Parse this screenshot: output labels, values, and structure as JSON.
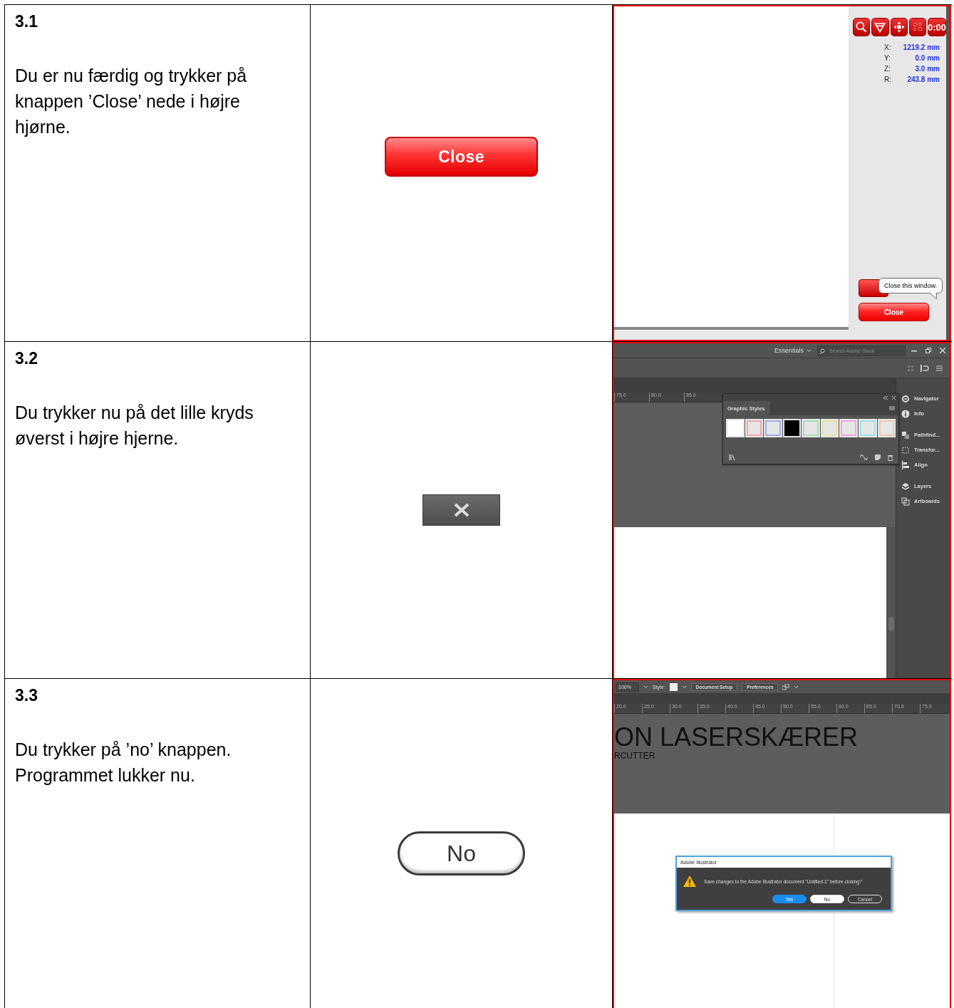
{
  "rows": [
    {
      "step": "3.1",
      "instruction": "Du er nu færdig og trykker på knappen ’Close’ nede i højre hjørne.",
      "button": {
        "kind": "red",
        "label": "Close"
      },
      "screenshot": {
        "kind": "laser-panel",
        "toolbar": {
          "timer": "0:00"
        },
        "coordinates": [
          {
            "axis": "X:",
            "value": "1219.2 mm"
          },
          {
            "axis": "Y:",
            "value": "0.0 mm"
          },
          {
            "axis": "Z:",
            "value": "3.0 mm"
          },
          {
            "axis": "R:",
            "value": "243.8 mm"
          }
        ],
        "tooltip": "Close this window.",
        "close_button": "Close"
      }
    },
    {
      "step": "3.2",
      "instruction": "Du trykker nu på det lille kryds øverst i højre hjerne.",
      "button": {
        "kind": "close-x"
      },
      "screenshot": {
        "kind": "illustrator-panels",
        "workspace": "Essentials",
        "search": {
          "placeholder": "Search Adobe Stock"
        },
        "ruler": [
          "75.0",
          "80.0",
          "85.0"
        ],
        "panel": {
          "title": "Graphic Styles",
          "swatches": [
            {
              "color": "#ffffff"
            },
            {
              "color": "#f2a9a9"
            },
            {
              "color": "#a9a9ea"
            },
            {
              "color": "#000000"
            },
            {
              "color": "#a6dfb0"
            },
            {
              "color": "#e6e4a8"
            },
            {
              "color": "#efa8e0"
            },
            {
              "color": "#a6e0e6"
            },
            {
              "color": "#f3c7ae"
            }
          ]
        },
        "dock": [
          {
            "label": "Navigator"
          },
          {
            "label": "Info"
          },
          {
            "label": "Pathfind..."
          },
          {
            "label": "Transfor..."
          },
          {
            "label": "Align"
          },
          {
            "label": "Layers"
          },
          {
            "label": "Artboards"
          }
        ]
      }
    },
    {
      "step": "3.3",
      "instruction": "Du trykker på ’no’ knappen. Programmet lukker nu.",
      "button": {
        "kind": "pill",
        "label": "No"
      },
      "screenshot": {
        "kind": "illustrator-dialog",
        "zoom": "100%",
        "style_label": "Style:",
        "control_buttons": [
          "Document Setup",
          "Preferences"
        ],
        "ruler": [
          "20.0",
          "25.0",
          "30.0",
          "35.0",
          "40.0",
          "45.0",
          "50.0",
          "55.0",
          "60.0",
          "65.0",
          "70.0",
          "75.0"
        ],
        "heading": "ON LASERSKÆRER",
        "subheading": "RCUTTER",
        "dialog": {
          "title": "Adobe Illustrator",
          "message": "Save changes to the Adobe Illustrator document \"Untitled-1\" before closing?",
          "buttons": [
            {
              "label": "Yes",
              "default": true
            },
            {
              "label": "No",
              "default": false
            },
            {
              "label": "Cancel",
              "default": false
            }
          ]
        }
      }
    }
  ]
}
